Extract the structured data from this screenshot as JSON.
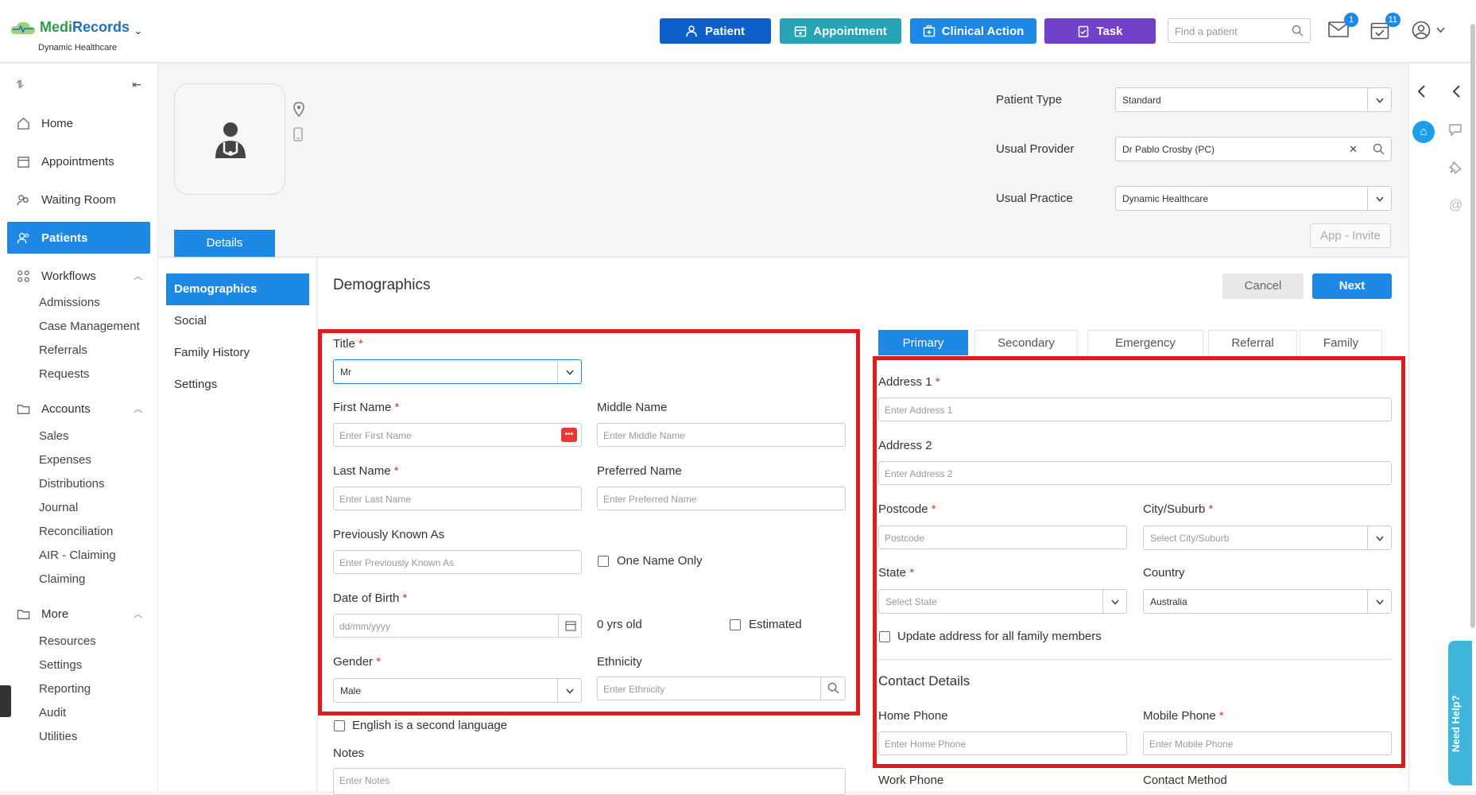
{
  "app": {
    "name_part1": "Medi",
    "name_part2": "Records",
    "practice": "Dynamic Healthcare"
  },
  "quick_actions": [
    {
      "label": "Patient",
      "color": "#0d5fc9"
    },
    {
      "label": "Appointment",
      "color": "#26a3b4"
    },
    {
      "label": "Clinical Action",
      "color": "#1e88e5"
    },
    {
      "label": "Task",
      "color": "#7141c9"
    }
  ],
  "search": {
    "placeholder": "Find a patient"
  },
  "header": {
    "mail_count": "1",
    "tasks_count": "11"
  },
  "sidebar": {
    "home": "Home",
    "appointments": "Appointments",
    "waiting_room": "Waiting Room",
    "patients": "Patients",
    "workflows": "Workflows",
    "workflows_items": [
      "Admissions",
      "Case Management",
      "Referrals",
      "Requests"
    ],
    "accounts": "Accounts",
    "accounts_items": [
      "Sales",
      "Expenses",
      "Distributions",
      "Journal",
      "Reconciliation",
      "AIR - Claiming",
      "Claiming"
    ],
    "more": "More",
    "more_items": [
      "Resources",
      "Settings",
      "Reporting",
      "Audit",
      "Utilities"
    ]
  },
  "patient_header": {
    "patient_type_label": "Patient Type",
    "patient_type_value": "Standard",
    "usual_provider_label": "Usual Provider",
    "usual_provider_value": "Dr Pablo Crosby (PC)",
    "usual_practice_label": "Usual Practice",
    "usual_practice_value": "Dynamic Healthcare",
    "app_invite": "App - Invite"
  },
  "details_tab": "Details",
  "left_menu": [
    "Demographics",
    "Social",
    "Family History",
    "Settings"
  ],
  "demographics": {
    "title": "Demographics",
    "cancel": "Cancel",
    "next": "Next",
    "title_label": "Title",
    "title_value": "Mr",
    "first_name_label": "First Name",
    "first_name_placeholder": "Enter First Name",
    "middle_name_label": "Middle Name",
    "middle_name_placeholder": "Enter Middle Name",
    "last_name_label": "Last Name",
    "last_name_placeholder": "Enter Last Name",
    "preferred_name_label": "Preferred Name",
    "preferred_name_placeholder": "Enter Preferred Name",
    "prev_known_label": "Previously Known As",
    "prev_known_placeholder": "Enter Previously Known As",
    "one_name_only": "One Name Only",
    "dob_label": "Date of Birth",
    "dob_placeholder": "dd/mm/yyyy",
    "age": "0 yrs old",
    "estimated": "Estimated",
    "gender_label": "Gender",
    "gender_value": "Male",
    "ethnicity_label": "Ethnicity",
    "ethnicity_placeholder": "Enter Ethnicity",
    "english_second": "English is a second language",
    "notes_label": "Notes",
    "notes_placeholder": "Enter Notes"
  },
  "address_tabs": [
    "Primary",
    "Secondary",
    "Emergency",
    "Referral",
    "Family"
  ],
  "address": {
    "address1_label": "Address 1",
    "address1_placeholder": "Enter Address 1",
    "address2_label": "Address 2",
    "address2_placeholder": "Enter Address 2",
    "postcode_label": "Postcode",
    "postcode_placeholder": "Postcode",
    "city_label": "City/Suburb",
    "city_placeholder": "Select City/Suburb",
    "state_label": "State",
    "state_placeholder": "Select State",
    "country_label": "Country",
    "country_value": "Australia",
    "update_family": "Update address for all family members",
    "contact_details": "Contact Details",
    "home_phone_label": "Home Phone",
    "home_phone_placeholder": "Enter Home Phone",
    "mobile_phone_label": "Mobile Phone",
    "mobile_phone_placeholder": "Enter Mobile Phone",
    "work_phone_label": "Work Phone",
    "contact_method_label": "Contact Method"
  },
  "need_help": "Need Help?"
}
